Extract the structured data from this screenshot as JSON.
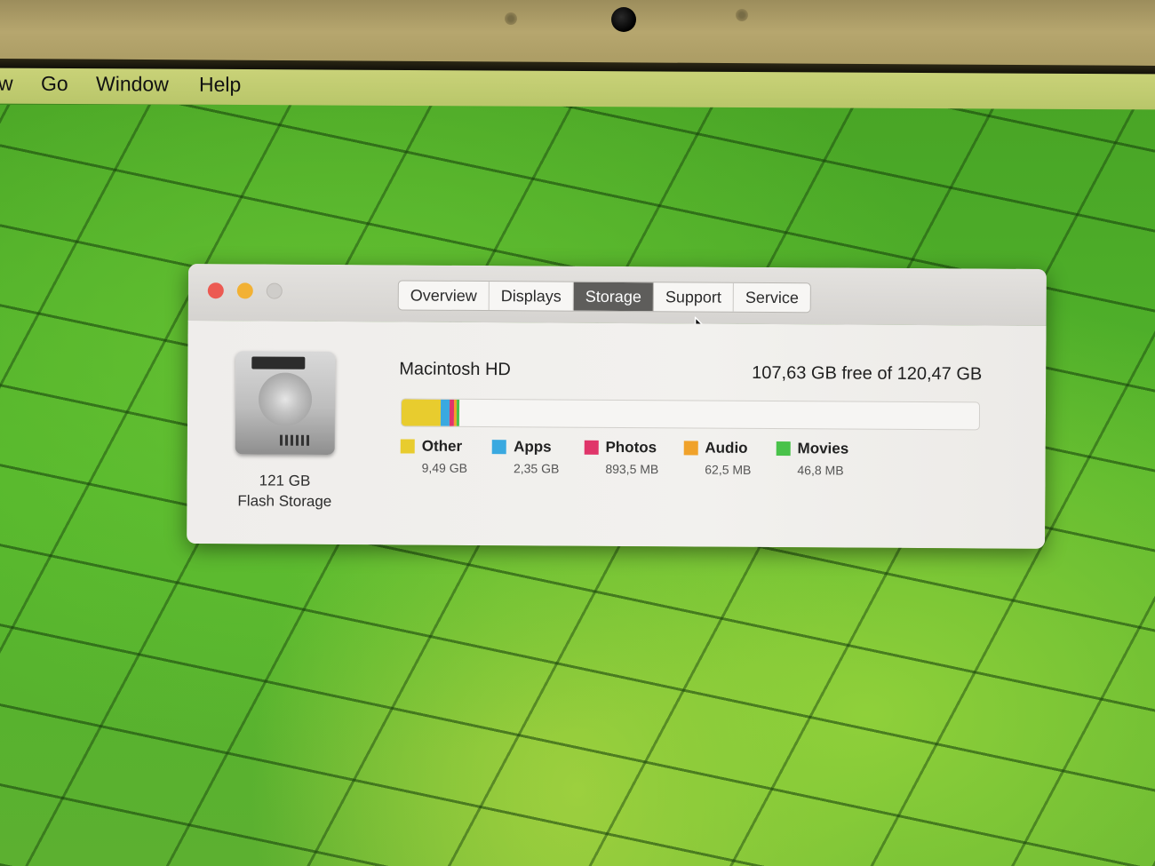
{
  "menubar": {
    "items": [
      "w",
      "Go",
      "Window",
      "Help"
    ]
  },
  "window": {
    "tabs": [
      {
        "label": "Overview",
        "active": false
      },
      {
        "label": "Displays",
        "active": false
      },
      {
        "label": "Storage",
        "active": true
      },
      {
        "label": "Support",
        "active": false
      },
      {
        "label": "Service",
        "active": false
      }
    ],
    "disk": {
      "capacity": "121 GB",
      "type": "Flash Storage"
    },
    "volume": {
      "name": "Macintosh HD",
      "free_text": "107,63 GB free of 120,47 GB",
      "usage_fraction_of_bar": 0.107
    },
    "legend": [
      {
        "name": "Other",
        "size": "9,49 GB",
        "color": "#e8cc2e"
      },
      {
        "name": "Apps",
        "size": "2,35 GB",
        "color": "#3aa9e0"
      },
      {
        "name": "Photos",
        "size": "893,5 MB",
        "color": "#e0356a"
      },
      {
        "name": "Audio",
        "size": "62,5 MB",
        "color": "#f0a22a"
      },
      {
        "name": "Movies",
        "size": "46,8 MB",
        "color": "#49c24a"
      }
    ],
    "traffic_lights": {
      "close": "#ec5a52",
      "minimize": "#f2b134",
      "zoom": "#cfcdca"
    }
  }
}
